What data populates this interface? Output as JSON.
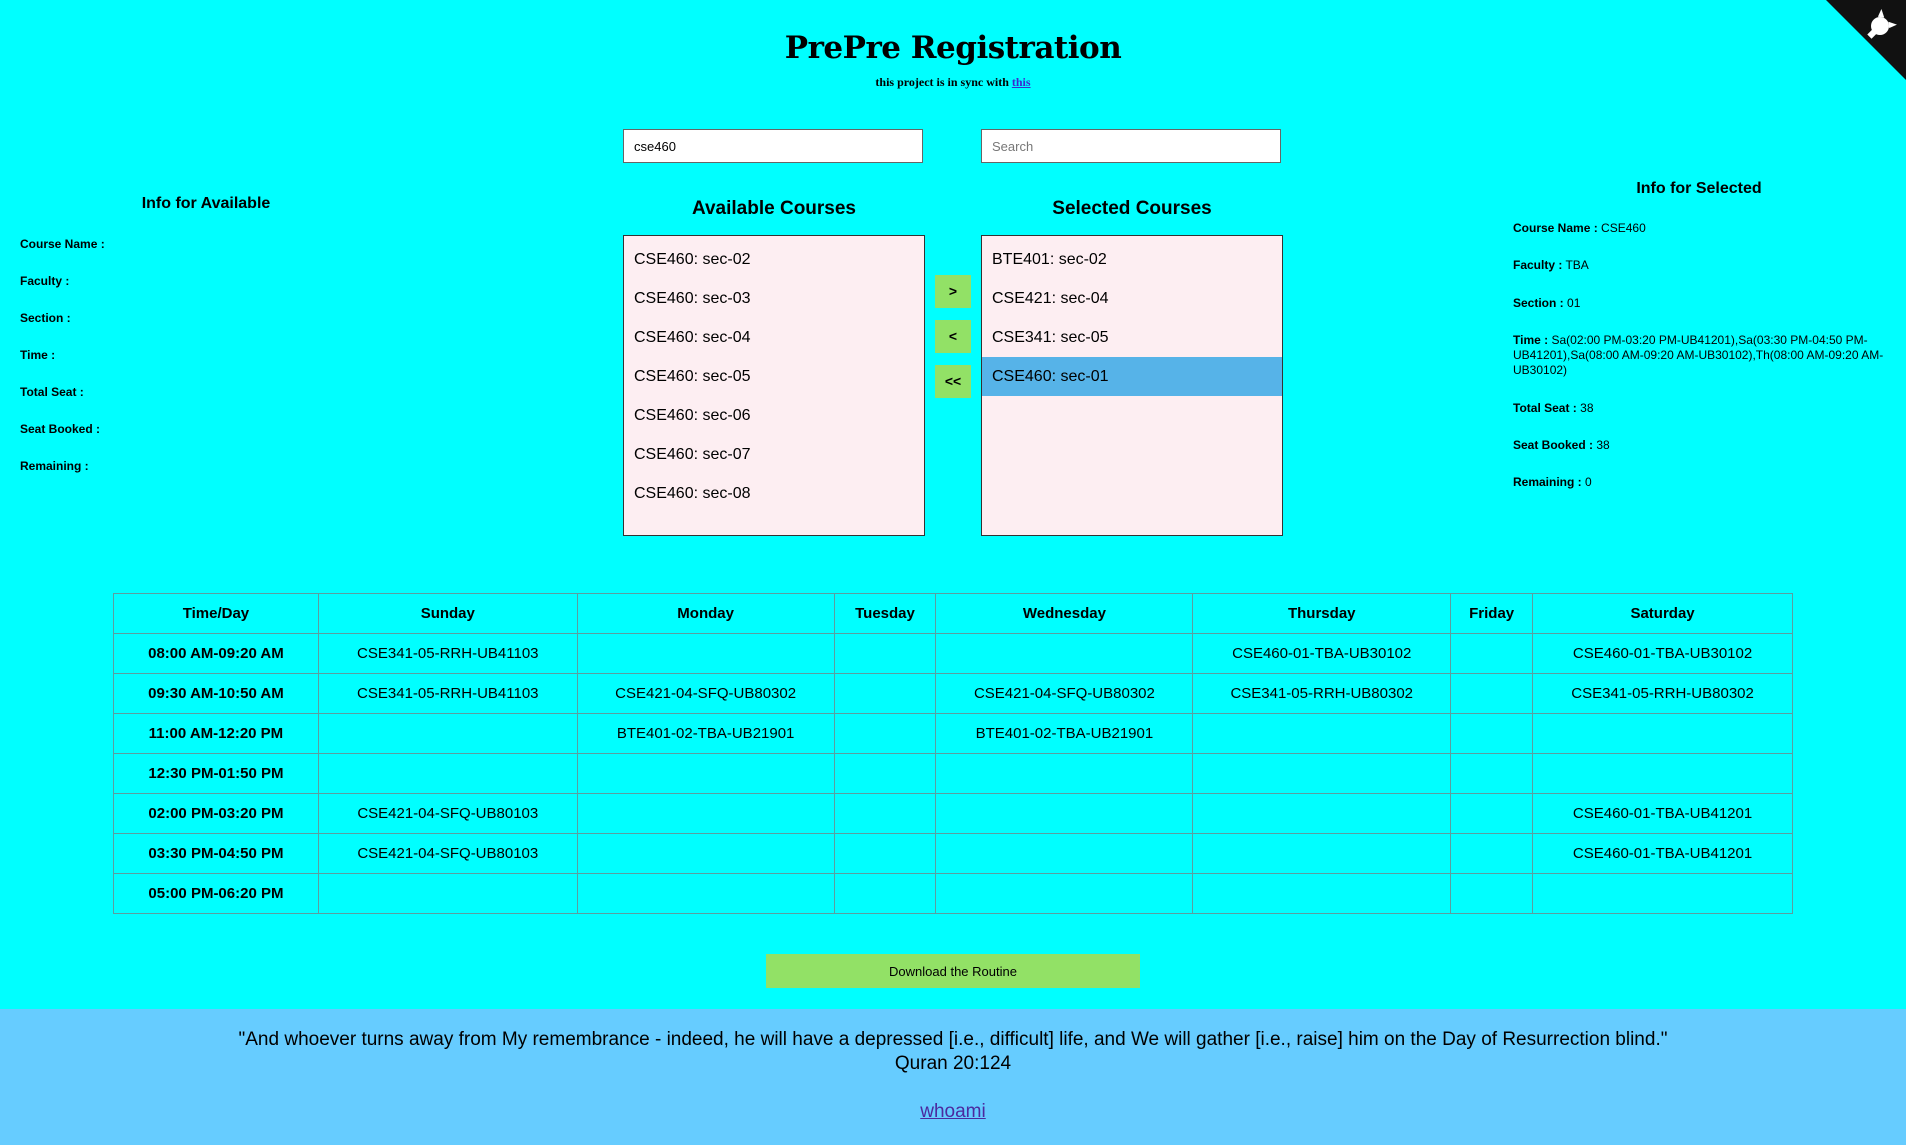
{
  "header": {
    "title": "PrePre Registration",
    "subtitle_text": "this project is in sync with",
    "subtitle_link": "this"
  },
  "search": {
    "available_value": "cse460",
    "selected_placeholder": "Search"
  },
  "available": {
    "heading": "Available Courses",
    "items": [
      "CSE460: sec-02",
      "CSE460: sec-03",
      "CSE460: sec-04",
      "CSE460: sec-05",
      "CSE460: sec-06",
      "CSE460: sec-07",
      "CSE460: sec-08"
    ]
  },
  "selected": {
    "heading": "Selected Courses",
    "items": [
      "BTE401: sec-02",
      "CSE421: sec-04",
      "CSE341: sec-05",
      "CSE460: sec-01"
    ],
    "highlighted_index": 3
  },
  "buttons": {
    "add": ">",
    "remove": "<",
    "remove_all": "<<",
    "download": "Download the Routine"
  },
  "info_available": {
    "heading": "Info for Available",
    "course_name_label": "Course Name :",
    "faculty_label": "Faculty :",
    "section_label": "Section :",
    "time_label": "Time :",
    "total_seat_label": "Total Seat :",
    "seat_booked_label": "Seat Booked :",
    "remaining_label": "Remaining :"
  },
  "info_selected": {
    "heading": "Info for Selected",
    "course_name_label": "Course Name :",
    "course_name": "CSE460",
    "faculty_label": "Faculty :",
    "faculty": "TBA",
    "section_label": "Section :",
    "section": "01",
    "time_label": "Time :",
    "time": "Sa(02:00 PM-03:20 PM-UB41201),Sa(03:30 PM-04:50 PM-UB41201),Sa(08:00 AM-09:20 AM-UB30102),Th(08:00 AM-09:20 AM-UB30102)",
    "total_seat_label": "Total Seat :",
    "total_seat": "38",
    "seat_booked_label": "Seat Booked :",
    "seat_booked": "38",
    "remaining_label": "Remaining :",
    "remaining": "0"
  },
  "routine": {
    "headers": [
      "Time/Day",
      "Sunday",
      "Monday",
      "Tuesday",
      "Wednesday",
      "Thursday",
      "Friday",
      "Saturday"
    ],
    "rows": [
      [
        "08:00 AM-09:20 AM",
        "CSE341-05-RRH-UB41103",
        "",
        "",
        "",
        "CSE460-01-TBA-UB30102",
        "",
        "CSE460-01-TBA-UB30102"
      ],
      [
        "09:30 AM-10:50 AM",
        "CSE341-05-RRH-UB41103",
        "CSE421-04-SFQ-UB80302",
        "",
        "CSE421-04-SFQ-UB80302",
        "CSE341-05-RRH-UB80302",
        "",
        "CSE341-05-RRH-UB80302"
      ],
      [
        "11:00 AM-12:20 PM",
        "",
        "BTE401-02-TBA-UB21901",
        "",
        "BTE401-02-TBA-UB21901",
        "",
        "",
        ""
      ],
      [
        "12:30 PM-01:50 PM",
        "",
        "",
        "",
        "",
        "",
        "",
        ""
      ],
      [
        "02:00 PM-03:20 PM",
        "CSE421-04-SFQ-UB80103",
        "",
        "",
        "",
        "",
        "",
        "CSE460-01-TBA-UB41201"
      ],
      [
        "03:30 PM-04:50 PM",
        "CSE421-04-SFQ-UB80103",
        "",
        "",
        "",
        "",
        "",
        "CSE460-01-TBA-UB41201"
      ],
      [
        "05:00 PM-06:20 PM",
        "",
        "",
        "",
        "",
        "",
        "",
        ""
      ]
    ]
  },
  "footer": {
    "quote": "\"And whoever turns away from My remembrance - indeed, he will have a depressed [i.e., difficult] life, and We will gather [i.e., raise] him on the Day of Resurrection blind.\"",
    "reference": "Quran 20:124",
    "link": "whoami"
  },
  "colors": {
    "background": "#00ffff",
    "footer": "#66ccff",
    "button": "#92e166",
    "list_bg": "#fdeef2",
    "highlight": "#56b3e8"
  },
  "icons": {
    "corner": "github-octocat-icon"
  }
}
